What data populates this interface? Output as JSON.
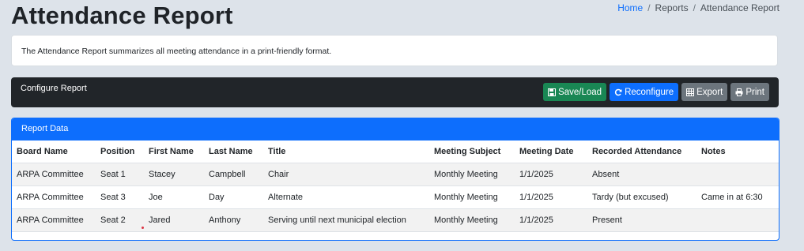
{
  "page": {
    "title": "Attendance Report"
  },
  "breadcrumb": {
    "home": "Home",
    "sep": "/",
    "reports": "Reports",
    "current": "Attendance Report"
  },
  "description": "The Attendance Report summarizes all meeting attendance in a print-friendly format.",
  "config": {
    "title": "Configure Report",
    "buttons": {
      "save_load": "Save/Load",
      "reconfigure": "Reconfigure",
      "export": "Export",
      "print": "Print"
    }
  },
  "report": {
    "header": "Report Data",
    "columns": [
      "Board Name",
      "Position",
      "First Name",
      "Last Name",
      "Title",
      "Meeting Subject",
      "Meeting Date",
      "Recorded Attendance",
      "Notes"
    ],
    "rows": [
      [
        "ARPA Committee",
        "Seat 1",
        "Stacey",
        "Campbell",
        "Chair",
        "Monthly Meeting",
        "1/1/2025",
        "Absent",
        ""
      ],
      [
        "ARPA Committee",
        "Seat 3",
        "Joe",
        "Day",
        "Alternate",
        "Monthly Meeting",
        "1/1/2025",
        "Tardy (but excused)",
        "Came in at 6:30"
      ],
      [
        "ARPA Committee",
        "Seat 2",
        "Jared",
        "Anthony",
        "Serving until next municipal election",
        "Monthly Meeting",
        "1/1/2025",
        "Present",
        ""
      ]
    ]
  },
  "colors": {
    "primary": "#0d6efd",
    "success": "#198754",
    "secondary": "#6c757d",
    "dark": "#212529"
  }
}
